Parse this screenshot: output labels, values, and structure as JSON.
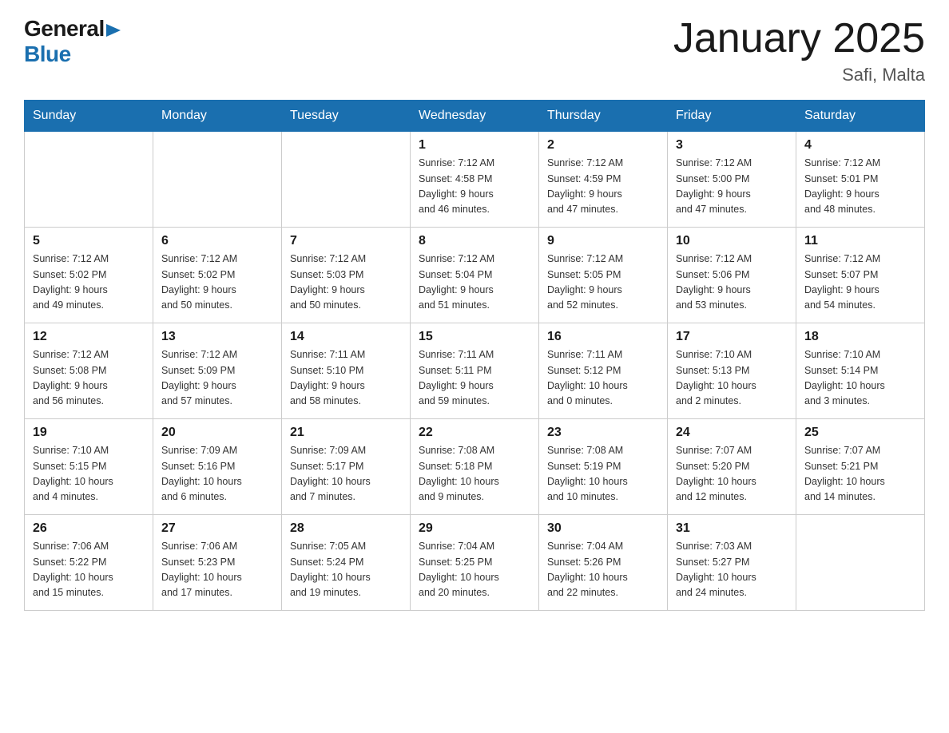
{
  "logo": {
    "general": "General",
    "blue": "Blue"
  },
  "title": "January 2025",
  "subtitle": "Safi, Malta",
  "days_of_week": [
    "Sunday",
    "Monday",
    "Tuesday",
    "Wednesday",
    "Thursday",
    "Friday",
    "Saturday"
  ],
  "weeks": [
    [
      {
        "day": "",
        "info": ""
      },
      {
        "day": "",
        "info": ""
      },
      {
        "day": "",
        "info": ""
      },
      {
        "day": "1",
        "info": "Sunrise: 7:12 AM\nSunset: 4:58 PM\nDaylight: 9 hours\nand 46 minutes."
      },
      {
        "day": "2",
        "info": "Sunrise: 7:12 AM\nSunset: 4:59 PM\nDaylight: 9 hours\nand 47 minutes."
      },
      {
        "day": "3",
        "info": "Sunrise: 7:12 AM\nSunset: 5:00 PM\nDaylight: 9 hours\nand 47 minutes."
      },
      {
        "day": "4",
        "info": "Sunrise: 7:12 AM\nSunset: 5:01 PM\nDaylight: 9 hours\nand 48 minutes."
      }
    ],
    [
      {
        "day": "5",
        "info": "Sunrise: 7:12 AM\nSunset: 5:02 PM\nDaylight: 9 hours\nand 49 minutes."
      },
      {
        "day": "6",
        "info": "Sunrise: 7:12 AM\nSunset: 5:02 PM\nDaylight: 9 hours\nand 50 minutes."
      },
      {
        "day": "7",
        "info": "Sunrise: 7:12 AM\nSunset: 5:03 PM\nDaylight: 9 hours\nand 50 minutes."
      },
      {
        "day": "8",
        "info": "Sunrise: 7:12 AM\nSunset: 5:04 PM\nDaylight: 9 hours\nand 51 minutes."
      },
      {
        "day": "9",
        "info": "Sunrise: 7:12 AM\nSunset: 5:05 PM\nDaylight: 9 hours\nand 52 minutes."
      },
      {
        "day": "10",
        "info": "Sunrise: 7:12 AM\nSunset: 5:06 PM\nDaylight: 9 hours\nand 53 minutes."
      },
      {
        "day": "11",
        "info": "Sunrise: 7:12 AM\nSunset: 5:07 PM\nDaylight: 9 hours\nand 54 minutes."
      }
    ],
    [
      {
        "day": "12",
        "info": "Sunrise: 7:12 AM\nSunset: 5:08 PM\nDaylight: 9 hours\nand 56 minutes."
      },
      {
        "day": "13",
        "info": "Sunrise: 7:12 AM\nSunset: 5:09 PM\nDaylight: 9 hours\nand 57 minutes."
      },
      {
        "day": "14",
        "info": "Sunrise: 7:11 AM\nSunset: 5:10 PM\nDaylight: 9 hours\nand 58 minutes."
      },
      {
        "day": "15",
        "info": "Sunrise: 7:11 AM\nSunset: 5:11 PM\nDaylight: 9 hours\nand 59 minutes."
      },
      {
        "day": "16",
        "info": "Sunrise: 7:11 AM\nSunset: 5:12 PM\nDaylight: 10 hours\nand 0 minutes."
      },
      {
        "day": "17",
        "info": "Sunrise: 7:10 AM\nSunset: 5:13 PM\nDaylight: 10 hours\nand 2 minutes."
      },
      {
        "day": "18",
        "info": "Sunrise: 7:10 AM\nSunset: 5:14 PM\nDaylight: 10 hours\nand 3 minutes."
      }
    ],
    [
      {
        "day": "19",
        "info": "Sunrise: 7:10 AM\nSunset: 5:15 PM\nDaylight: 10 hours\nand 4 minutes."
      },
      {
        "day": "20",
        "info": "Sunrise: 7:09 AM\nSunset: 5:16 PM\nDaylight: 10 hours\nand 6 minutes."
      },
      {
        "day": "21",
        "info": "Sunrise: 7:09 AM\nSunset: 5:17 PM\nDaylight: 10 hours\nand 7 minutes."
      },
      {
        "day": "22",
        "info": "Sunrise: 7:08 AM\nSunset: 5:18 PM\nDaylight: 10 hours\nand 9 minutes."
      },
      {
        "day": "23",
        "info": "Sunrise: 7:08 AM\nSunset: 5:19 PM\nDaylight: 10 hours\nand 10 minutes."
      },
      {
        "day": "24",
        "info": "Sunrise: 7:07 AM\nSunset: 5:20 PM\nDaylight: 10 hours\nand 12 minutes."
      },
      {
        "day": "25",
        "info": "Sunrise: 7:07 AM\nSunset: 5:21 PM\nDaylight: 10 hours\nand 14 minutes."
      }
    ],
    [
      {
        "day": "26",
        "info": "Sunrise: 7:06 AM\nSunset: 5:22 PM\nDaylight: 10 hours\nand 15 minutes."
      },
      {
        "day": "27",
        "info": "Sunrise: 7:06 AM\nSunset: 5:23 PM\nDaylight: 10 hours\nand 17 minutes."
      },
      {
        "day": "28",
        "info": "Sunrise: 7:05 AM\nSunset: 5:24 PM\nDaylight: 10 hours\nand 19 minutes."
      },
      {
        "day": "29",
        "info": "Sunrise: 7:04 AM\nSunset: 5:25 PM\nDaylight: 10 hours\nand 20 minutes."
      },
      {
        "day": "30",
        "info": "Sunrise: 7:04 AM\nSunset: 5:26 PM\nDaylight: 10 hours\nand 22 minutes."
      },
      {
        "day": "31",
        "info": "Sunrise: 7:03 AM\nSunset: 5:27 PM\nDaylight: 10 hours\nand 24 minutes."
      },
      {
        "day": "",
        "info": ""
      }
    ]
  ]
}
